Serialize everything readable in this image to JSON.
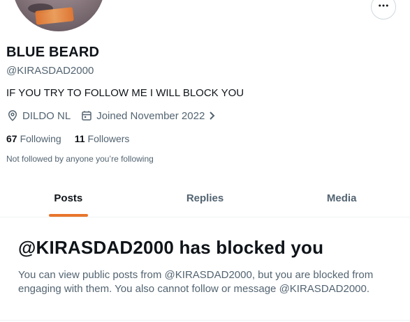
{
  "profile": {
    "display_name": "BLUE BEARD",
    "handle": "@KIRASDAD2000",
    "bio": "IF YOU TRY TO FOLLOW ME I WILL BLOCK YOU",
    "location": "DILDO NL",
    "joined": "Joined November 2022",
    "following_count": "67",
    "following_label": "Following",
    "followers_count": "11",
    "followers_label": "Followers",
    "followed_by_note": "Not followed by anyone you’re following"
  },
  "icons": {
    "more": "more-horizontal-icon",
    "location": "location-pin-icon",
    "calendar": "calendar-icon",
    "chevron": "chevron-right-icon"
  },
  "tabs": [
    {
      "label": "Posts",
      "active": true
    },
    {
      "label": "Replies",
      "active": false
    },
    {
      "label": "Media",
      "active": false
    }
  ],
  "blocked": {
    "title": "@KIRASDAD2000 has blocked you",
    "message": "You can view public posts from @KIRASDAD2000, but you are blocked from engaging with them. You also cannot follow or message @KIRASDAD2000."
  },
  "colors": {
    "accent": "#e8762d",
    "secondary_text": "#536471",
    "primary_text": "#0f1419",
    "divider": "#eff3f4"
  }
}
